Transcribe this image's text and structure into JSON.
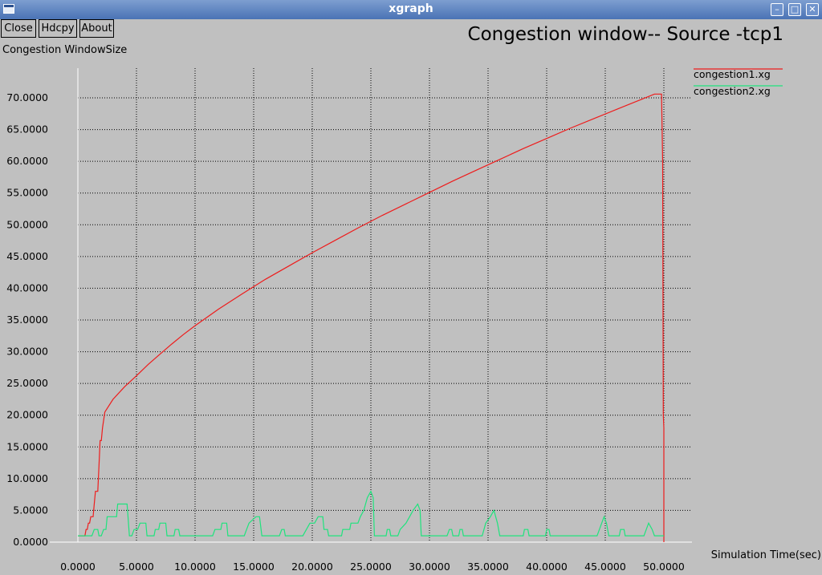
{
  "window": {
    "title": "xgraph"
  },
  "buttons": {
    "close": "Close",
    "hdcpy": "Hdcpy",
    "about": "About"
  },
  "colors": {
    "background": "#c0c0c0",
    "grid": "#000000",
    "axis": "#ffffff",
    "series1": "#ee1c1c",
    "series2": "#1fe37d"
  },
  "chart_data": {
    "type": "line",
    "title": "Congestion window-- Source -tcp1",
    "ylabel": "Congestion WindowSize",
    "xlabel": "Simulation Time(sec)",
    "xlim": [
      0,
      50
    ],
    "ylim": [
      0,
      70
    ],
    "grid": true,
    "legend_position": "top-right",
    "x_ticks": [
      "0.0000",
      "5.0000",
      "10.0000",
      "15.0000",
      "20.0000",
      "25.0000",
      "30.0000",
      "35.0000",
      "40.0000",
      "45.0000",
      "50.0000"
    ],
    "y_ticks": [
      "0.0000",
      "5.0000",
      "10.0000",
      "15.0000",
      "20.0000",
      "25.0000",
      "30.0000",
      "35.0000",
      "40.0000",
      "45.0000",
      "50.0000",
      "55.0000",
      "60.0000",
      "65.0000",
      "70.0000"
    ],
    "series": [
      {
        "name": "congestion1.xg",
        "color": "#ee1c1c",
        "points": [
          [
            0,
            1
          ],
          [
            0.6,
            1
          ],
          [
            0.7,
            2
          ],
          [
            0.8,
            2
          ],
          [
            0.9,
            3
          ],
          [
            1.0,
            3
          ],
          [
            1.1,
            4
          ],
          [
            1.3,
            4
          ],
          [
            1.4,
            6
          ],
          [
            1.5,
            8
          ],
          [
            1.7,
            8
          ],
          [
            1.8,
            12
          ],
          [
            1.9,
            16
          ],
          [
            2.0,
            16
          ],
          [
            2.1,
            18
          ],
          [
            2.3,
            20.5
          ],
          [
            3,
            22.5
          ],
          [
            4,
            24.5
          ],
          [
            5,
            26.2
          ],
          [
            6,
            28
          ],
          [
            7,
            29.6
          ],
          [
            8,
            31.2
          ],
          [
            9,
            32.7
          ],
          [
            10,
            34.1
          ],
          [
            12,
            36.7
          ],
          [
            14,
            39.1
          ],
          [
            16,
            41.4
          ],
          [
            18,
            43.5
          ],
          [
            20,
            45.6
          ],
          [
            22,
            47.6
          ],
          [
            24,
            49.6
          ],
          [
            26,
            51.5
          ],
          [
            28,
            53.3
          ],
          [
            30,
            55.1
          ],
          [
            32,
            56.9
          ],
          [
            34,
            58.6
          ],
          [
            36,
            60.3
          ],
          [
            38,
            62
          ],
          [
            40,
            63.6
          ],
          [
            42,
            65.2
          ],
          [
            44,
            66.7
          ],
          [
            46,
            68.2
          ],
          [
            48,
            69.7
          ],
          [
            49.2,
            70.6
          ],
          [
            49.8,
            70.6
          ],
          [
            49.9,
            60
          ],
          [
            49.95,
            20
          ],
          [
            50,
            18
          ],
          [
            50,
            0
          ]
        ]
      },
      {
        "name": "congestion2.xg",
        "color": "#1fe37d",
        "points": [
          [
            0,
            1
          ],
          [
            1,
            1
          ],
          [
            1.2,
            1
          ],
          [
            1.4,
            2
          ],
          [
            1.7,
            2
          ],
          [
            1.8,
            1
          ],
          [
            2,
            1
          ],
          [
            2.2,
            2
          ],
          [
            2.4,
            2
          ],
          [
            2.5,
            4
          ],
          [
            3.3,
            4
          ],
          [
            3.4,
            6
          ],
          [
            4.2,
            6
          ],
          [
            4.4,
            1
          ],
          [
            4.6,
            1
          ],
          [
            4.8,
            2
          ],
          [
            5.1,
            2
          ],
          [
            5.3,
            3
          ],
          [
            5.8,
            3
          ],
          [
            5.9,
            1
          ],
          [
            6.5,
            1
          ],
          [
            6.6,
            2
          ],
          [
            6.9,
            2
          ],
          [
            7.0,
            3
          ],
          [
            7.5,
            3
          ],
          [
            7.6,
            1
          ],
          [
            8.2,
            1
          ],
          [
            8.3,
            2
          ],
          [
            8.6,
            2
          ],
          [
            8.7,
            1
          ],
          [
            9,
            1
          ],
          [
            11.5,
            1
          ],
          [
            11.7,
            2
          ],
          [
            12.2,
            2
          ],
          [
            12.3,
            3
          ],
          [
            12.7,
            3
          ],
          [
            12.8,
            1
          ],
          [
            14.2,
            1
          ],
          [
            14.4,
            2
          ],
          [
            14.6,
            3
          ],
          [
            15.2,
            4
          ],
          [
            15.5,
            4
          ],
          [
            15.7,
            1
          ],
          [
            17.2,
            1
          ],
          [
            17.4,
            2
          ],
          [
            17.6,
            2
          ],
          [
            17.7,
            1
          ],
          [
            19.2,
            1
          ],
          [
            19.5,
            2
          ],
          [
            19.8,
            3
          ],
          [
            20.2,
            3
          ],
          [
            20.5,
            4
          ],
          [
            20.9,
            4
          ],
          [
            21,
            2
          ],
          [
            21.3,
            2
          ],
          [
            21.4,
            1
          ],
          [
            22.5,
            1
          ],
          [
            22.6,
            2
          ],
          [
            23.2,
            2
          ],
          [
            23.3,
            3
          ],
          [
            23.9,
            3
          ],
          [
            24.1,
            4
          ],
          [
            24.4,
            5
          ],
          [
            24.7,
            7
          ],
          [
            25,
            8
          ],
          [
            25.2,
            7
          ],
          [
            25.3,
            1
          ],
          [
            26.3,
            1
          ],
          [
            26.4,
            2
          ],
          [
            26.6,
            2
          ],
          [
            26.7,
            1
          ],
          [
            27.3,
            1
          ],
          [
            27.5,
            2
          ],
          [
            28,
            3
          ],
          [
            28.6,
            5
          ],
          [
            29,
            6
          ],
          [
            29.2,
            5
          ],
          [
            29.3,
            1
          ],
          [
            31.5,
            1
          ],
          [
            31.7,
            2
          ],
          [
            31.9,
            2
          ],
          [
            32,
            1
          ],
          [
            32.5,
            1
          ],
          [
            32.6,
            2
          ],
          [
            32.8,
            2
          ],
          [
            32.9,
            1
          ],
          [
            34.5,
            1
          ],
          [
            34.8,
            3
          ],
          [
            35.2,
            4
          ],
          [
            35.5,
            5
          ],
          [
            35.8,
            3
          ],
          [
            36,
            1
          ],
          [
            38,
            1
          ],
          [
            38.1,
            2
          ],
          [
            38.4,
            2
          ],
          [
            38.5,
            1
          ],
          [
            39.9,
            1
          ],
          [
            40,
            2
          ],
          [
            40.2,
            2
          ],
          [
            40.3,
            1
          ],
          [
            44.3,
            1
          ],
          [
            44.5,
            2
          ],
          [
            44.7,
            3
          ],
          [
            44.9,
            4
          ],
          [
            45.1,
            3
          ],
          [
            45.3,
            1
          ],
          [
            46.2,
            1
          ],
          [
            46.3,
            2
          ],
          [
            46.6,
            2
          ],
          [
            46.7,
            1
          ],
          [
            48.3,
            1
          ],
          [
            48.5,
            2
          ],
          [
            48.7,
            3
          ],
          [
            49,
            2
          ],
          [
            49.2,
            1
          ],
          [
            50,
            1
          ]
        ]
      }
    ]
  }
}
